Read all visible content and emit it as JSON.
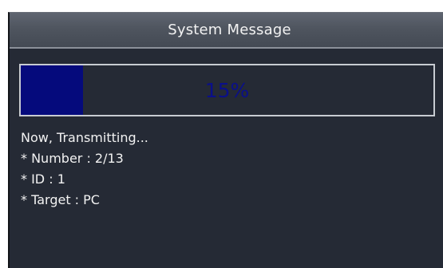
{
  "dialog": {
    "title": "System Message",
    "progress": {
      "percent": 15,
      "label": "15%"
    },
    "status_lines": [
      "Now, Transmitting...",
      "* Number : 2/13",
      "* ID : 1",
      "* Target : PC"
    ]
  },
  "colors": {
    "dialog_background": "#252a35",
    "title_bar": "#4f555f",
    "progress_fill": "#050a7c",
    "progress_text": "#0a0f8a",
    "text": "#f2f2f2"
  }
}
